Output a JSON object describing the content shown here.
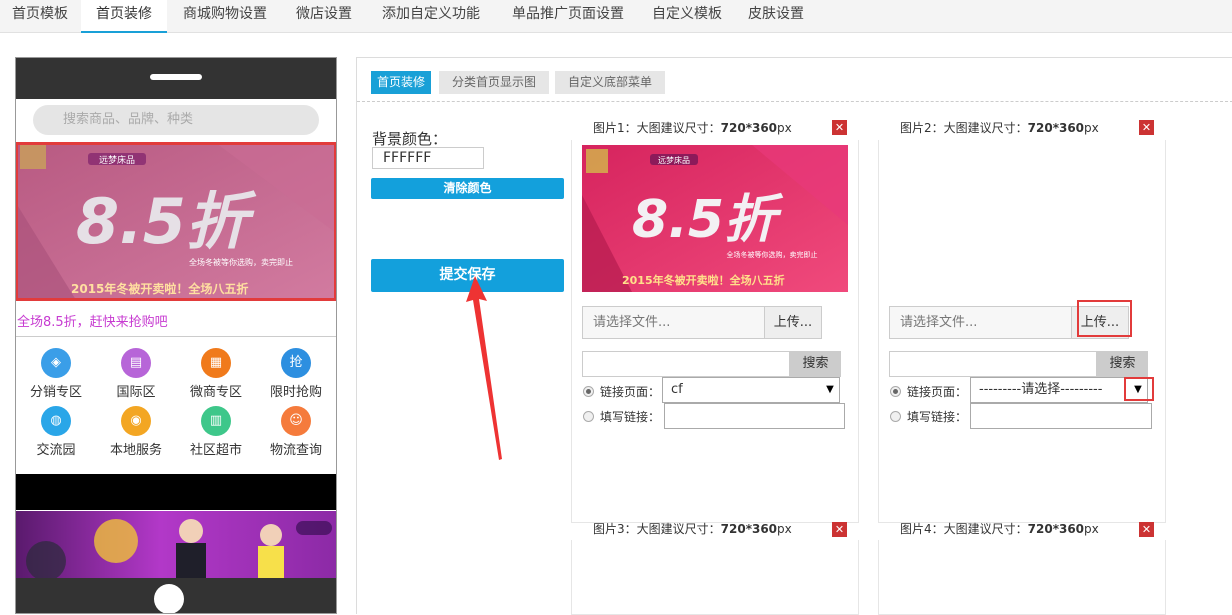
{
  "top_tabs": [
    "首页模板",
    "首页装修",
    "商城购物设置",
    "微店设置",
    "添加自定义功能",
    "单品推广页面设置",
    "自定义模板",
    "皮肤设置"
  ],
  "active_tab": "首页装修",
  "preview": {
    "search_placeholder": "搜索商品、品牌、种类",
    "banner": {
      "brand": "远梦床品",
      "big_text": "8.5折",
      "sub_text": "全场冬被等你选购，卖完即止",
      "bottom_text": "2015年冬被开卖啦！全场八五折"
    },
    "promo_text": "全场8.5折，赶快来抢购吧",
    "categories": [
      {
        "label": "分销专区",
        "icon": "diamond-icon",
        "color": "#3a9ee8",
        "glyph": "◈"
      },
      {
        "label": "国际区",
        "icon": "shopping-bag-icon",
        "color": "#b765d8",
        "glyph": "▤"
      },
      {
        "label": "微商专区",
        "icon": "store-icon",
        "color": "#f07a1b",
        "glyph": "▦"
      },
      {
        "label": "限时抢购",
        "icon": "flash-sale-icon",
        "color": "#2d8fe0",
        "glyph": "抢"
      },
      {
        "label": "交流园",
        "icon": "chat-icon",
        "color": "#2aa6e8",
        "glyph": "◍"
      },
      {
        "label": "本地服务",
        "icon": "location-icon",
        "color": "#f3a623",
        "glyph": "◉"
      },
      {
        "label": "社区超市",
        "icon": "market-icon",
        "color": "#3ec78a",
        "glyph": "▥"
      },
      {
        "label": "物流查询",
        "icon": "user-icon",
        "color": "#f57b3c",
        "glyph": "☺"
      }
    ]
  },
  "sub_tabs": [
    "首页装修",
    "分类首页显示图",
    "自定义底部菜单"
  ],
  "active_sub_tab": "首页装修",
  "background": {
    "label": "背景颜色：",
    "value": "FFFFFF",
    "clear_label": "清除颜色",
    "submit_label": "提交保存"
  },
  "cards": [
    {
      "title_prefix": "图片1：大图建议尺寸：",
      "size": "720*360",
      "unit": "px",
      "file_placeholder": "请选择文件...",
      "upload_label": "上传...",
      "search_label": "搜索",
      "link_page_label": "链接页面：",
      "link_page_value": "cf",
      "custom_link_label": "填写链接："
    },
    {
      "title_prefix": "图片2：大图建议尺寸：",
      "size": "720*360",
      "unit": "px",
      "file_placeholder": "请选择文件...",
      "upload_label": "上传...",
      "search_label": "搜索",
      "link_page_label": "链接页面：",
      "link_page_value": "---------请选择---------",
      "custom_link_label": "填写链接："
    },
    {
      "title_prefix": "图片3：大图建议尺寸：",
      "size": "720*360",
      "unit": "px"
    },
    {
      "title_prefix": "图片4：大图建议尺寸：",
      "size": "720*360",
      "unit": "px"
    }
  ]
}
